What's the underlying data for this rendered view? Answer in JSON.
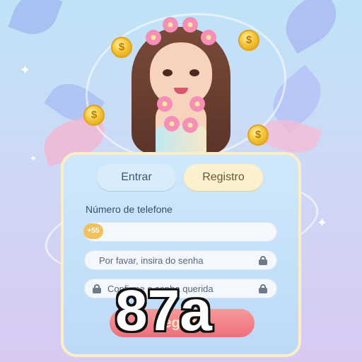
{
  "tabs": {
    "login_label": "Entrar",
    "register_label": "Registro",
    "active": "register"
  },
  "form": {
    "phone_label": "Número de telefone",
    "country_code": "+55",
    "phone_value": "",
    "password_placeholder": "Por favar, insira do senha",
    "confirm_placeholder": "Confirme a senha querida",
    "submit_label": "Registro"
  },
  "overlay_text": "87a",
  "colors": {
    "accent_register": "#fbf1cf",
    "button": "#ee6f7c",
    "coin": "#f5c739"
  },
  "icons": [
    "lock-icon",
    "coin-icon",
    "sparkle-icon",
    "flower-icon"
  ]
}
